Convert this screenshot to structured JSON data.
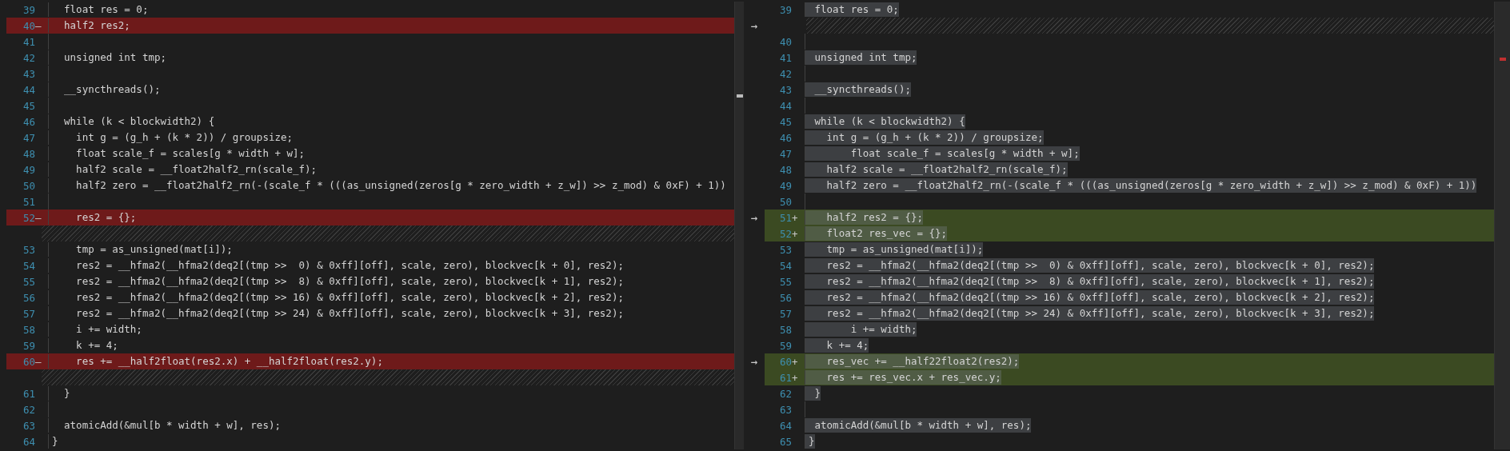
{
  "right_text_highlighted": true,
  "rows": [
    {
      "left": {
        "kind": "unchanged",
        "number": "39",
        "code": "  float res = 0;"
      },
      "right": {
        "kind": "unchanged",
        "number": "39",
        "code": " float res = 0;"
      }
    },
    {
      "left": {
        "kind": "removed",
        "number": "40",
        "marker": "—",
        "code": "  half2 res2;"
      },
      "arrow": "→",
      "right": {
        "kind": "filler"
      }
    },
    {
      "left": {
        "kind": "unchanged",
        "number": "41"
      },
      "right": {
        "kind": "unchanged",
        "number": "40"
      }
    },
    {
      "left": {
        "kind": "unchanged",
        "number": "42",
        "code": "  unsigned int tmp;"
      },
      "right": {
        "kind": "unchanged",
        "number": "41",
        "code": " unsigned int tmp;"
      }
    },
    {
      "left": {
        "kind": "unchanged",
        "number": "43"
      },
      "right": {
        "kind": "unchanged",
        "number": "42"
      }
    },
    {
      "left": {
        "kind": "unchanged",
        "number": "44",
        "code": "  __syncthreads();"
      },
      "right": {
        "kind": "unchanged",
        "number": "43",
        "code": " __syncthreads();"
      }
    },
    {
      "left": {
        "kind": "unchanged",
        "number": "45"
      },
      "right": {
        "kind": "unchanged",
        "number": "44"
      }
    },
    {
      "left": {
        "kind": "unchanged",
        "number": "46",
        "code": "  while (k < blockwidth2) {"
      },
      "right": {
        "kind": "unchanged",
        "number": "45",
        "code": " while (k < blockwidth2) {"
      }
    },
    {
      "left": {
        "kind": "unchanged",
        "number": "47",
        "code": "    int g = (g_h + (k * 2)) / groupsize;"
      },
      "right": {
        "kind": "unchanged",
        "number": "46",
        "code": "   int g = (g_h + (k * 2)) / groupsize;"
      }
    },
    {
      "left": {
        "kind": "unchanged",
        "number": "48",
        "code": "    float scale_f = scales[g * width + w];"
      },
      "right": {
        "kind": "unchanged",
        "number": "47",
        "code": "       float scale_f = scales[g * width + w];"
      }
    },
    {
      "left": {
        "kind": "unchanged",
        "number": "49",
        "code": "    half2 scale = __float2half2_rn(scale_f);"
      },
      "right": {
        "kind": "unchanged",
        "number": "48",
        "code": "   half2 scale = __float2half2_rn(scale_f);"
      }
    },
    {
      "left": {
        "kind": "unchanged",
        "number": "50",
        "code": "    half2 zero = __float2half2_rn(-(scale_f * (((as_unsigned(zeros[g * zero_width + z_w]) >> z_mod) & 0xF) + 1))"
      },
      "right": {
        "kind": "unchanged",
        "number": "49",
        "code": "   half2 zero = __float2half2_rn(-(scale_f * (((as_unsigned(zeros[g * zero_width + z_w]) >> z_mod) & 0xF) + 1))"
      }
    },
    {
      "left": {
        "kind": "unchanged",
        "number": "51"
      },
      "right": {
        "kind": "unchanged",
        "number": "50"
      }
    },
    {
      "left": {
        "kind": "removed",
        "number": "52",
        "marker": "—",
        "code": "    res2 = {};"
      },
      "arrow": "→",
      "right": {
        "kind": "added",
        "number": "51",
        "marker": "+",
        "code": "   half2 res2 = {};"
      }
    },
    {
      "left": {
        "kind": "filler"
      },
      "right": {
        "kind": "added",
        "number": "52",
        "marker": "+",
        "code": "   float2 res_vec = {};"
      }
    },
    {
      "left": {
        "kind": "unchanged",
        "number": "53",
        "code": "    tmp = as_unsigned(mat[i]);"
      },
      "right": {
        "kind": "unchanged",
        "number": "53",
        "code": "   tmp = as_unsigned(mat[i]);"
      }
    },
    {
      "left": {
        "kind": "unchanged",
        "number": "54",
        "code": "    res2 = __hfma2(__hfma2(deq2[(tmp >>  0) & 0xff][off], scale, zero), blockvec[k + 0], res2);"
      },
      "right": {
        "kind": "unchanged",
        "number": "54",
        "code": "   res2 = __hfma2(__hfma2(deq2[(tmp >>  0) & 0xff][off], scale, zero), blockvec[k + 0], res2);"
      }
    },
    {
      "left": {
        "kind": "unchanged",
        "number": "55",
        "code": "    res2 = __hfma2(__hfma2(deq2[(tmp >>  8) & 0xff][off], scale, zero), blockvec[k + 1], res2);"
      },
      "right": {
        "kind": "unchanged",
        "number": "55",
        "code": "   res2 = __hfma2(__hfma2(deq2[(tmp >>  8) & 0xff][off], scale, zero), blockvec[k + 1], res2);"
      }
    },
    {
      "left": {
        "kind": "unchanged",
        "number": "56",
        "code": "    res2 = __hfma2(__hfma2(deq2[(tmp >> 16) & 0xff][off], scale, zero), blockvec[k + 2], res2);"
      },
      "right": {
        "kind": "unchanged",
        "number": "56",
        "code": "   res2 = __hfma2(__hfma2(deq2[(tmp >> 16) & 0xff][off], scale, zero), blockvec[k + 2], res2);"
      }
    },
    {
      "left": {
        "kind": "unchanged",
        "number": "57",
        "code": "    res2 = __hfma2(__hfma2(deq2[(tmp >> 24) & 0xff][off], scale, zero), blockvec[k + 3], res2);"
      },
      "right": {
        "kind": "unchanged",
        "number": "57",
        "code": "   res2 = __hfma2(__hfma2(deq2[(tmp >> 24) & 0xff][off], scale, zero), blockvec[k + 3], res2);"
      }
    },
    {
      "left": {
        "kind": "unchanged",
        "number": "58",
        "code": "    i += width;"
      },
      "right": {
        "kind": "unchanged",
        "number": "58",
        "code": "       i += width;"
      }
    },
    {
      "left": {
        "kind": "unchanged",
        "number": "59",
        "code": "    k += 4;"
      },
      "right": {
        "kind": "unchanged",
        "number": "59",
        "code": "   k += 4;"
      }
    },
    {
      "left": {
        "kind": "removed",
        "number": "60",
        "marker": "—",
        "code": "    res += __half2float(res2.x) + __half2float(res2.y);"
      },
      "arrow": "→",
      "right": {
        "kind": "added",
        "number": "60",
        "marker": "+",
        "code": "   res_vec += __half22float2(res2);"
      }
    },
    {
      "left": {
        "kind": "filler"
      },
      "right": {
        "kind": "added",
        "number": "61",
        "marker": "+",
        "code": "   res += res_vec.x + res_vec.y;"
      }
    },
    {
      "left": {
        "kind": "unchanged",
        "number": "61",
        "code": "  }"
      },
      "right": {
        "kind": "unchanged",
        "number": "62",
        "code": " }"
      }
    },
    {
      "left": {
        "kind": "unchanged",
        "number": "62"
      },
      "right": {
        "kind": "unchanged",
        "number": "63"
      }
    },
    {
      "left": {
        "kind": "unchanged",
        "number": "63",
        "code": "  atomicAdd(&mul[b * width + w], res);"
      },
      "right": {
        "kind": "unchanged",
        "number": "64",
        "code": " atomicAdd(&mul[b * width + w], res);"
      }
    },
    {
      "left": {
        "kind": "unchanged",
        "number": "64",
        "code": "}"
      },
      "right": {
        "kind": "unchanged",
        "number": "65",
        "code": "}"
      }
    }
  ]
}
